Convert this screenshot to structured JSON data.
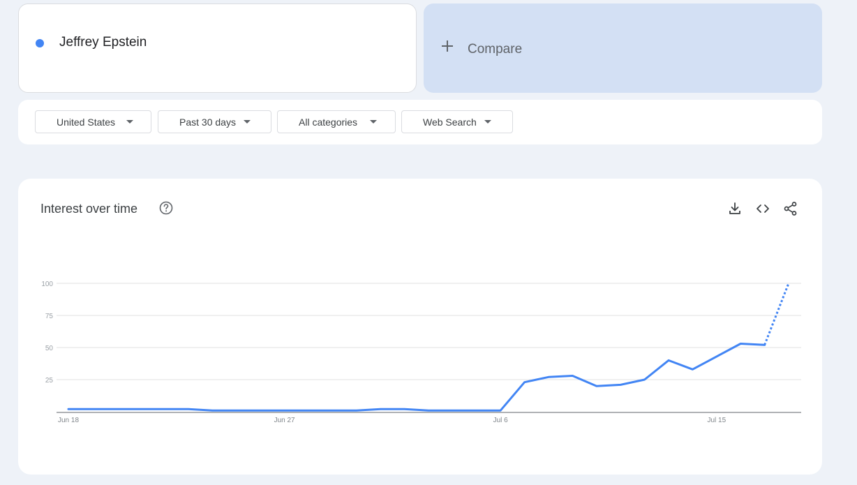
{
  "search": {
    "term": "Jeffrey Epstein",
    "term_color": "#4285f4",
    "compare_label": "Compare"
  },
  "filters": {
    "region": "United States",
    "time_range": "Past 30 days",
    "category": "All categories",
    "property": "Web Search"
  },
  "chart_section": {
    "title": "Interest over time",
    "icons": [
      "help-icon",
      "download-icon",
      "embed-icon",
      "share-icon"
    ]
  },
  "chart_data": {
    "type": "line",
    "title": "Interest over time",
    "xlabel": "",
    "ylabel": "",
    "ylim": [
      0,
      100
    ],
    "y_ticks": [
      25,
      50,
      75,
      100
    ],
    "x_tick_labels": [
      "Jun 18",
      "Jun 27",
      "Jul 6",
      "Jul 15"
    ],
    "grid": true,
    "color": "#4285f4",
    "series": [
      {
        "x": [
          "Jun 18",
          "Jun 19",
          "Jun 20",
          "Jun 21",
          "Jun 22",
          "Jun 23",
          "Jun 24",
          "Jun 25",
          "Jun 26",
          "Jun 27",
          "Jun 28",
          "Jun 29",
          "Jun 30",
          "Jul 1",
          "Jul 2",
          "Jul 3",
          "Jul 4",
          "Jul 5",
          "Jul 6",
          "Jul 7",
          "Jul 8",
          "Jul 9",
          "Jul 10",
          "Jul 11",
          "Jul 12",
          "Jul 13",
          "Jul 14",
          "Jul 15",
          "Jul 16",
          "Jul 17",
          "Jul 18"
        ],
        "values": [
          2,
          2,
          2,
          2,
          2,
          2,
          1,
          1,
          1,
          1,
          1,
          1,
          1,
          2,
          2,
          1,
          1,
          1,
          1,
          23,
          27,
          28,
          20,
          21,
          25,
          40,
          33,
          43,
          53,
          52,
          100
        ],
        "partial_from_index": 29
      }
    ]
  }
}
